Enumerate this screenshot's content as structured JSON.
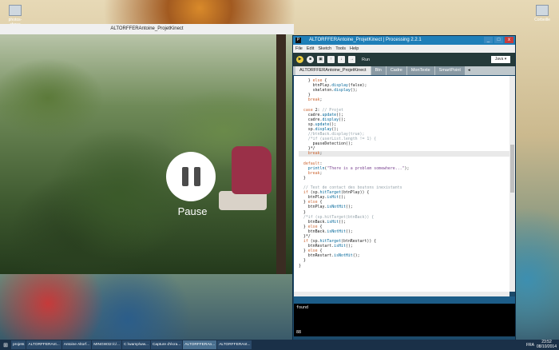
{
  "desktop": {
    "icons": [
      {
        "label": "photos-chose"
      },
      {
        "label": "Corbeille"
      }
    ]
  },
  "sketch_window": {
    "title": "ALTORFFERAntoine_ProjetKinect",
    "pause_label": "Pause"
  },
  "ide": {
    "title": "ALTORFFERAntoine_ProjetKinect | Processing 2.2.1",
    "logo": "P",
    "window_controls": [
      "_",
      "□",
      "x"
    ],
    "menu": [
      "File",
      "Edit",
      "Sketch",
      "Tools",
      "Help"
    ],
    "toolbar_buttons": [
      {
        "name": "run",
        "icon": "▶"
      },
      {
        "name": "stop",
        "icon": "■"
      },
      {
        "name": "new",
        "icon": "▣"
      },
      {
        "name": "open",
        "icon": "↑"
      },
      {
        "name": "save",
        "icon": "↓"
      },
      {
        "name": "export",
        "icon": "→"
      }
    ],
    "run_label": "Run",
    "mode": "Java ▾",
    "tabs": [
      {
        "label": "ALTORFFERAntoine_ProjetKinect",
        "active": true
      },
      {
        "label": "Btn",
        "active": false
      },
      {
        "label": "Cadre",
        "active": false
      },
      {
        "label": "MonTexte",
        "active": false
      },
      {
        "label": "SmartPoint",
        "active": false
      }
    ],
    "tab_arrow": "◂",
    "code_lines": [
      "    } else {",
      "      btnPlay.display(false);",
      "      skeleton.display();",
      "    }",
      "    break;",
      "",
      "  case 2: // Projet",
      "    cadre.update();",
      "    cadre.display();",
      "    sp.update();",
      "    sp.display();",
      "    //btnBack.display(true);",
      "    /*if (userList.length != 1) {",
      "      pauseDetection();",
      "    }*/",
      "    break;",
      "",
      "  default:",
      "    println(\"There is a problem somewhere...\");",
      "    break;",
      "  }",
      "",
      "  // Test de contact des boutons inexistants",
      "  if (sp.hitTarget(btnPlay)) {",
      "    btnPlay.isHit();",
      "  } else {",
      "    btnPlay.isNotHit();",
      "  }",
      "  /*if (sp.hitTarget(btnBack)) {",
      "    btnBack.isHit();",
      "  } else {",
      "    btnBack.isNotHit();",
      "  }*/",
      "  if (sp.hitTarget(btnRestart)) {",
      "    btnRestart.isHit();",
      "  } else {",
      "    btnRestart.isNotHit();",
      "  }",
      "}"
    ],
    "highlighted_line": 15,
    "console_text": "found",
    "line_number": "88"
  },
  "taskbar": {
    "start_icon": "⊞",
    "items": [
      {
        "label": "projets",
        "active": false
      },
      {
        "label": "ALTORFFERAnt...",
        "active": false
      },
      {
        "label": "Antoine Altorf...",
        "active": false
      },
      {
        "label": "MINGW32:/c/...",
        "active": false
      },
      {
        "label": "C:\\wamp\\ww...",
        "active": false
      },
      {
        "label": "Capture d'écra...",
        "active": false
      },
      {
        "label": "ALTORFFERAn...",
        "active": true
      },
      {
        "label": "ALTORFFERAnt...",
        "active": false
      }
    ],
    "language": "FRA",
    "time": "23:52",
    "date": "08/10/2014"
  }
}
